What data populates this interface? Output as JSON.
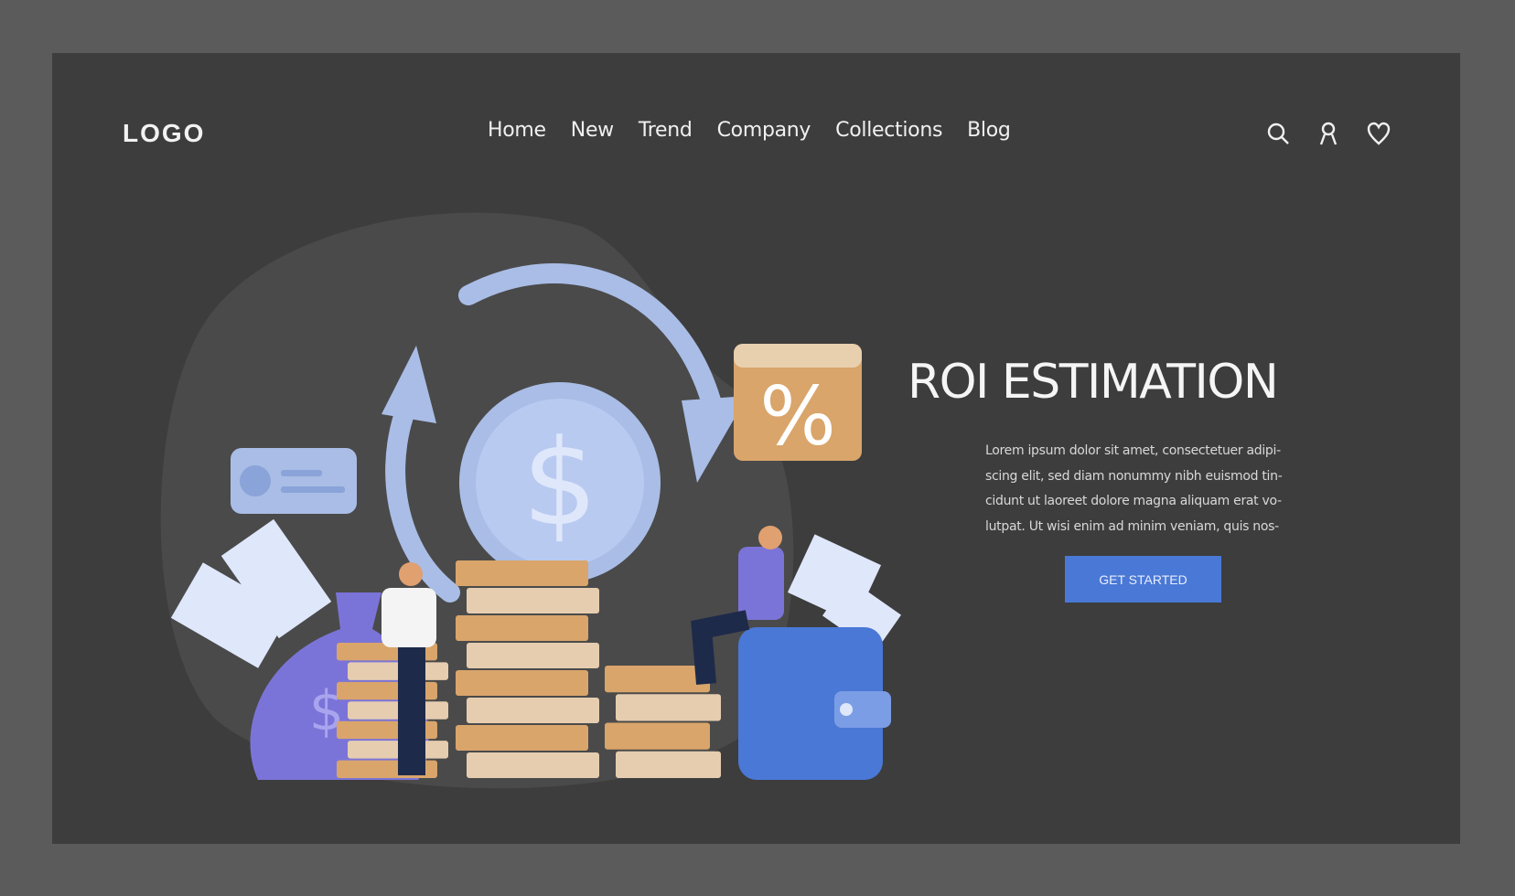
{
  "header": {
    "logo": "LOGO",
    "nav": [
      "Home",
      "New",
      "Trend",
      "Company",
      "Collections",
      "Blog"
    ],
    "icons": [
      "search-icon",
      "user-icon",
      "heart-icon"
    ]
  },
  "hero": {
    "title": "ROI ESTIMATION",
    "paragraph_lines": [
      "Lorem ipsum dolor sit amet, consectetuer adipi-",
      "scing elit, sed diam nonummy nibh euismod tin-",
      "cidunt ut laoreet dolore magna aliquam erat vo-",
      "lutpat. Ut wisi enim ad minim veniam, quis nos-"
    ],
    "cta": "GET STARTED",
    "illustration_symbols": {
      "coin": "$",
      "badge": "%",
      "bag": "$"
    }
  },
  "colors": {
    "background": "#5b5b5b",
    "panel": "#3d3d3d",
    "accent": "#4a78d6",
    "coin": "#d9a56b",
    "coin_light": "#e6cdb0",
    "blue_light": "#a9bde6",
    "purple": "#7b74d8"
  }
}
